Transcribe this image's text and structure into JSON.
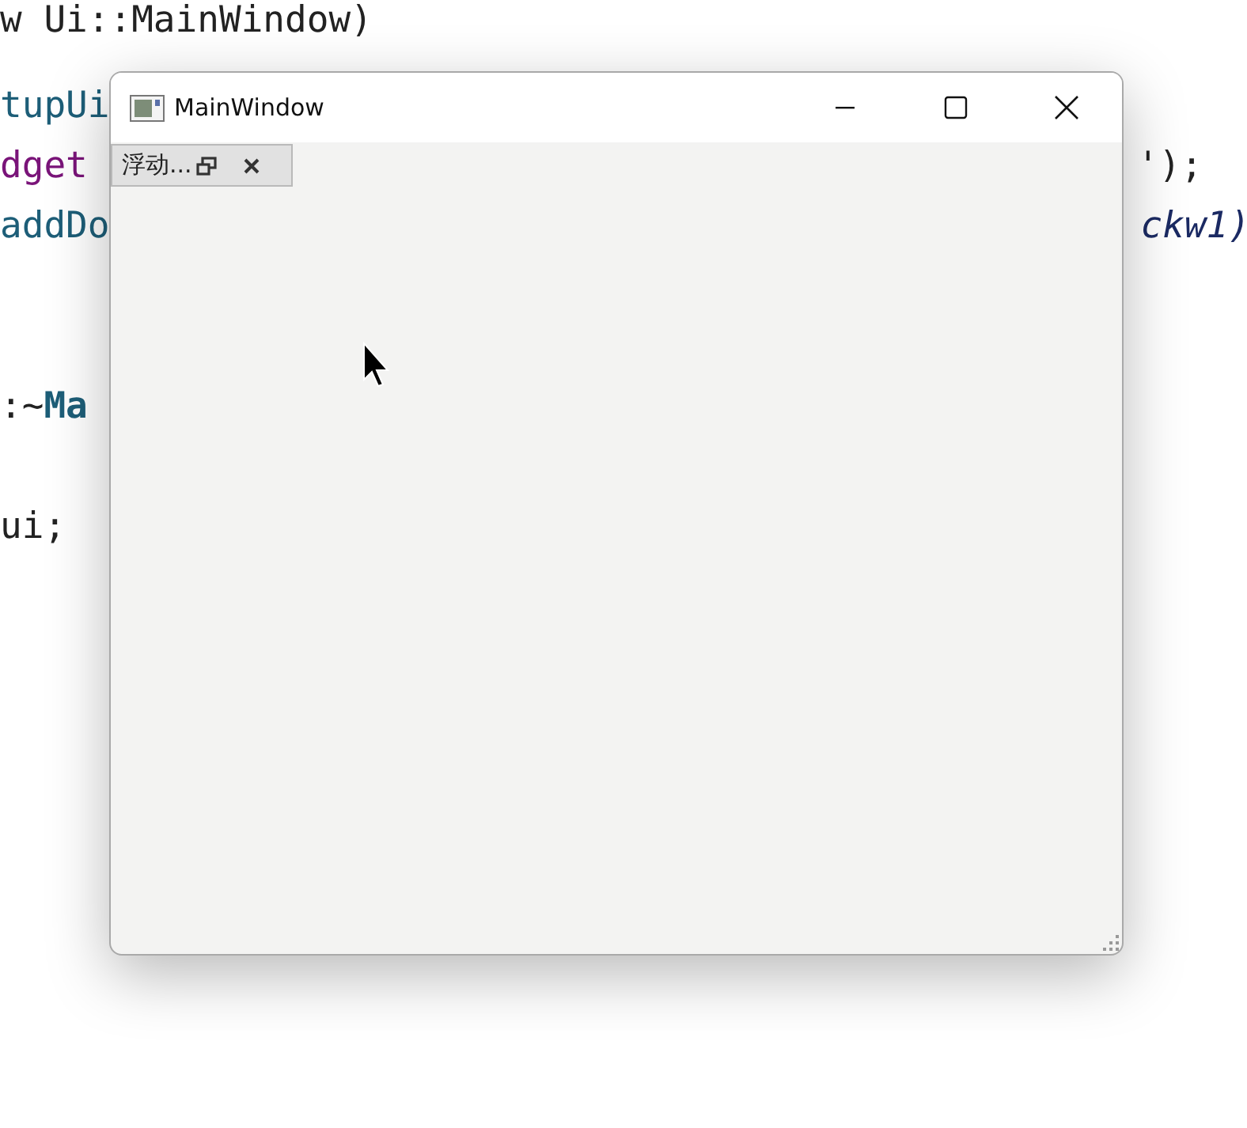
{
  "editor": {
    "code_lines": [
      {
        "left": [
          {
            "text": "w Ui::MainWindow)",
            "kind": "plain"
          }
        ]
      },
      {
        "left": [
          {
            "text": "tupUi",
            "kind": "type"
          }
        ]
      },
      {
        "left": [
          {
            "text": "dget",
            "kind": "keyword"
          }
        ],
        "right": [
          {
            "text": "');",
            "kind": "plain"
          }
        ]
      },
      {
        "left": [
          {
            "text": "addDo",
            "kind": "type"
          }
        ],
        "right": [
          {
            "text": "ckw1)",
            "kind": "param"
          }
        ]
      },
      {
        "left": [
          {
            "text": ":~",
            "kind": "plain"
          },
          {
            "text": "Ma",
            "kind": "class"
          }
        ]
      },
      {
        "left": [
          {
            "text": "ui;",
            "kind": "plain"
          }
        ]
      }
    ]
  },
  "window": {
    "title": "MainWindow",
    "dock_widget": {
      "title": "浮动..."
    }
  }
}
